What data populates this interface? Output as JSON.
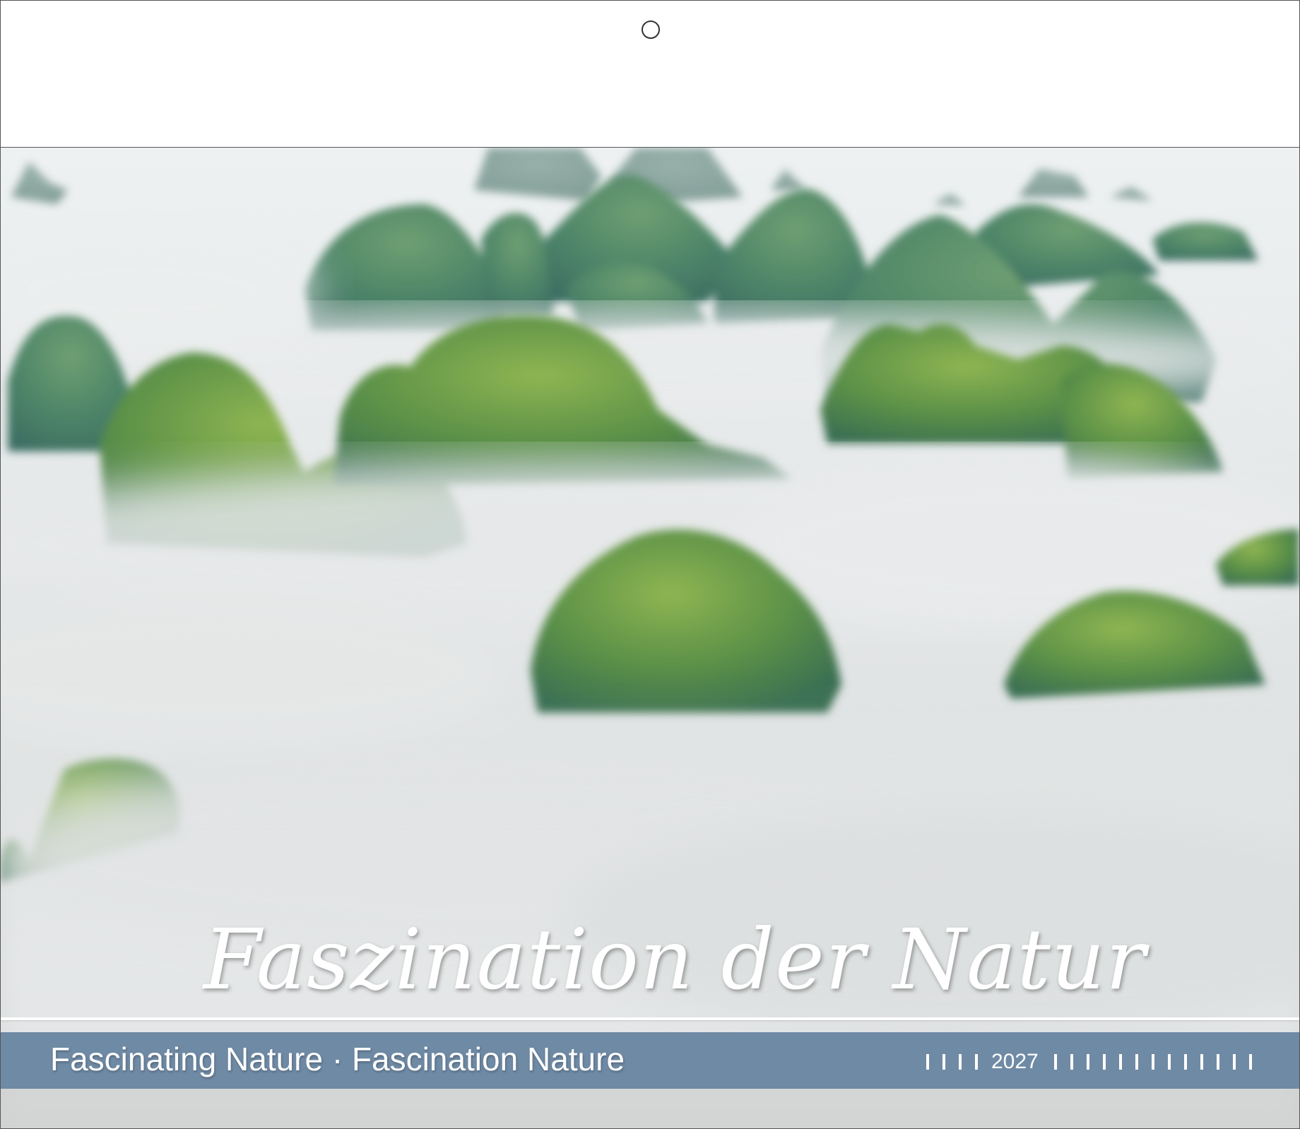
{
  "cover": {
    "title_script": "Faszination der Natur",
    "subtitle": "Fascinating Nature · Fascination Nature",
    "year": "2027",
    "ticks_before_year": 4,
    "ticks_after_year": 13
  },
  "colors": {
    "band": "#6f8aa5",
    "text": "#ffffff",
    "mist": "#e6e8e9",
    "hill_dark": "#3f7a55",
    "hill_light": "#7aa84a"
  },
  "image": {
    "subject": "misty karst-mountains-photo"
  }
}
